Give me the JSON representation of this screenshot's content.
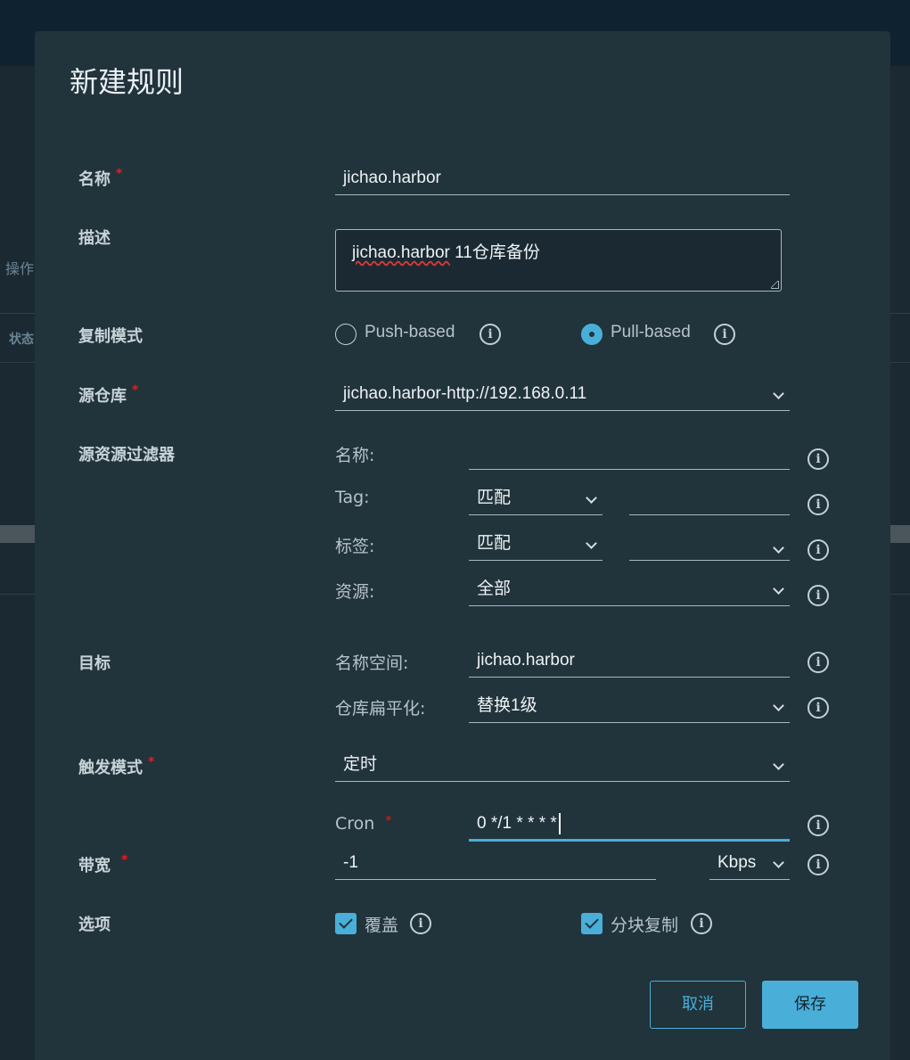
{
  "background": {
    "op_text": "操作",
    "status_text": "状态"
  },
  "modal": {
    "title": "新建规则",
    "name": {
      "label": "名称",
      "value": "jichao.harbor"
    },
    "description": {
      "label": "描述",
      "value_spell": "jichao.harbor",
      "value_rest": " 11仓库备份"
    },
    "replication_mode": {
      "label": "复制模式",
      "options": [
        {
          "label": "Push-based",
          "checked": false
        },
        {
          "label": "Pull-based",
          "checked": true
        }
      ]
    },
    "source_registry": {
      "label": "源仓库",
      "value": "jichao.harbor-http://192.168.0.11"
    },
    "source_filter": {
      "label": "源资源过滤器",
      "name_label": "名称:",
      "name_value": "",
      "tag_label": "Tag:",
      "tag_match": "匹配",
      "tag_value": "",
      "label_label": "标签:",
      "label_match": "匹配",
      "label_value": "",
      "resource_label": "资源:",
      "resource_value": "全部"
    },
    "destination": {
      "label": "目标",
      "namespace_label": "名称空间:",
      "namespace_value": "jichao.harbor",
      "flatten_label": "仓库扁平化:",
      "flatten_value": "替换1级"
    },
    "trigger": {
      "label": "触发模式",
      "value": "定时",
      "cron_label": "Cron",
      "cron_value": "0 */1 * * * *"
    },
    "bandwidth": {
      "label": "带宽",
      "value": "-1",
      "unit": "Kbps"
    },
    "options": {
      "label": "选项",
      "override_label": "覆盖",
      "override_checked": true,
      "chunk_label": "分块复制",
      "chunk_checked": true
    },
    "buttons": {
      "cancel": "取消",
      "save": "保存"
    },
    "info_glyph": "i",
    "required_mark": "*"
  },
  "colors": {
    "accent": "#49afd9",
    "modal_bg": "#21333b",
    "required": "#e02020"
  }
}
